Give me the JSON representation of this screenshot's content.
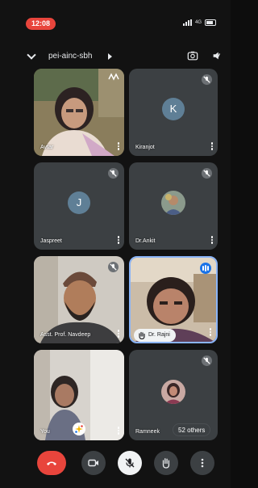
{
  "status_bar": {
    "time": "12:08",
    "network": "4G"
  },
  "header": {
    "meeting_code": "pei-ainc-sbh",
    "icons": [
      "chevron-down-icon",
      "camera-switch-icon",
      "audio-output-icon"
    ]
  },
  "participants": [
    {
      "name": "Avtar",
      "muted": false,
      "video": true
    },
    {
      "name": "Kiranjot",
      "muted": true,
      "video": false,
      "initial": "K"
    },
    {
      "name": "Jaspreet",
      "muted": true,
      "video": false,
      "initial": "J"
    },
    {
      "name": "Dr.Ankit",
      "muted": true,
      "video": false
    },
    {
      "name": "Asst. Prof. Navdeep",
      "muted": true,
      "video": true
    },
    {
      "name": "Dr. Rajni",
      "muted": false,
      "video": true,
      "speaking": true,
      "hand_raised": true
    },
    {
      "name": "You",
      "muted": false,
      "video": true
    },
    {
      "name": "Ramneek",
      "muted": true,
      "video": false
    }
  ],
  "others_label": "52 others",
  "controls": [
    "end-call",
    "camera",
    "microphone-off",
    "raise-hand",
    "more-options"
  ],
  "colors": {
    "end_call": "#e8453c",
    "speaking": "#1a73e8",
    "tile_bg": "#3c4043",
    "background": "#121212"
  }
}
